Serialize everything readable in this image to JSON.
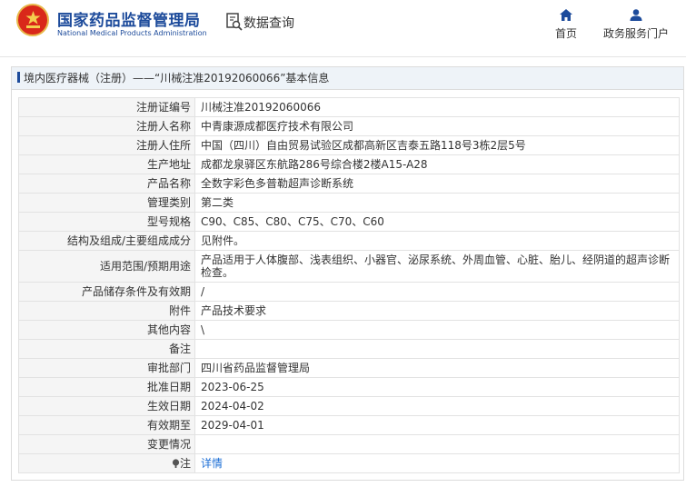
{
  "header": {
    "site_title_cn": "国家药品监督管理局",
    "site_title_en": "National Medical Products Administration",
    "query_label": "数据查询",
    "nav": [
      {
        "label": "首页",
        "icon": "home-icon"
      },
      {
        "label": "政务服务门户",
        "icon": "user-icon"
      }
    ]
  },
  "panel": {
    "breadcrumb": "境内医疗器械（注册）——“川械注准20192060066”基本信息"
  },
  "rows": [
    {
      "label": "注册证编号",
      "value": "川械注准20192060066"
    },
    {
      "label": "注册人名称",
      "value": "中青康源成都医疗技术有限公司"
    },
    {
      "label": "注册人住所",
      "value": "中国（四川）自由贸易试验区成都高新区吉泰五路118号3栋2层5号"
    },
    {
      "label": "生产地址",
      "value": "成都龙泉驿区东航路286号综合楼2楼A15-A28"
    },
    {
      "label": "产品名称",
      "value": "全数字彩色多普勒超声诊断系统"
    },
    {
      "label": "管理类别",
      "value": "第二类"
    },
    {
      "label": "型号规格",
      "value": "C90、C85、C80、C75、C70、C60"
    },
    {
      "label": "结构及组成/主要组成成分",
      "value": "见附件。"
    },
    {
      "label": "适用范围/预期用途",
      "value": "产品适用于人体腹部、浅表组织、小器官、泌尿系统、外周血管、心脏、胎儿、经阴道的超声诊断检查。"
    },
    {
      "label": "产品储存条件及有效期",
      "value": "/"
    },
    {
      "label": "附件",
      "value": "产品技术要求"
    },
    {
      "label": "其他内容",
      "value": "\\"
    },
    {
      "label": "备注",
      "value": ""
    },
    {
      "label": "审批部门",
      "value": "四川省药品监督管理局"
    },
    {
      "label": "批准日期",
      "value": "2023-06-25"
    },
    {
      "label": "生效日期",
      "value": "2024-04-02"
    },
    {
      "label": "有效期至",
      "value": "2029-04-01"
    },
    {
      "label": "变更情况",
      "value": ""
    }
  ],
  "note_row": {
    "label": "注",
    "icon": "info-icon",
    "link": "详情"
  }
}
